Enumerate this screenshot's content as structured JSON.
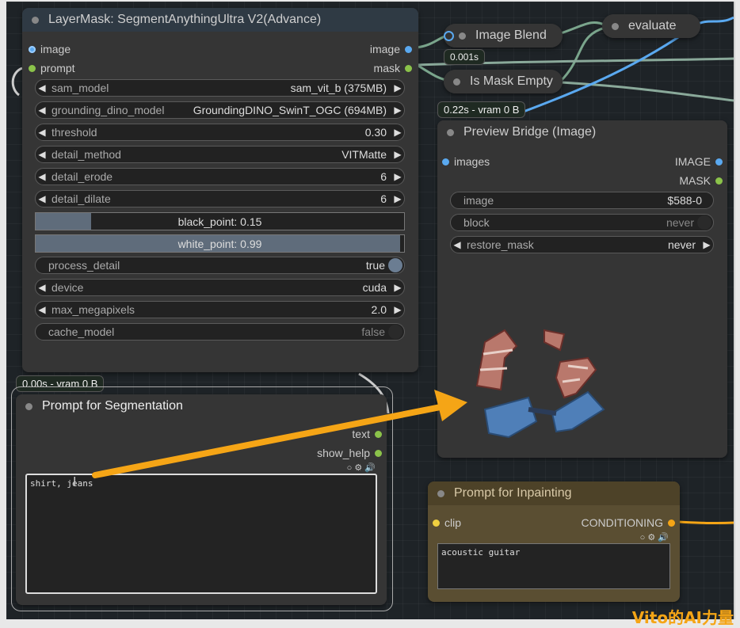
{
  "layer_mask": {
    "title": "LayerMask: SegmentAnythingUltra V2(Advance)",
    "inputs": [
      "image",
      "prompt"
    ],
    "outputs": [
      "image",
      "mask"
    ],
    "widgets": [
      {
        "label": "sam_model",
        "value": "sam_vit_b (375MB)"
      },
      {
        "label": "grounding_dino_model",
        "value": "GroundingDINO_SwinT_OGC (694MB)"
      },
      {
        "label": "threshold",
        "value": "0.30"
      },
      {
        "label": "detail_method",
        "value": "VITMatte"
      },
      {
        "label": "detail_erode",
        "value": "6"
      },
      {
        "label": "detail_dilate",
        "value": "6"
      }
    ],
    "black_point": "black_point: 0.15",
    "black_point_value": 0.15,
    "white_point": "white_point: 0.99",
    "white_point_value": 0.99,
    "process_detail": {
      "label": "process_detail",
      "value": "true"
    },
    "device": {
      "label": "device",
      "value": "cuda"
    },
    "max_megapixels": {
      "label": "max_megapixels",
      "value": "2.0"
    },
    "cache_model": {
      "label": "cache_model",
      "value": "false"
    }
  },
  "badges": {
    "segment": "0.00s - vram 0 B",
    "preview": "0.22s - vram 0 B",
    "blend": "0.001s"
  },
  "image_blend": {
    "title": "Image Blend"
  },
  "is_mask_empty": {
    "title": "Is Mask Empty"
  },
  "evaluate": {
    "title": "evaluate"
  },
  "preview_bridge": {
    "title": "Preview Bridge (Image)",
    "input": "images",
    "outputs": [
      "IMAGE",
      "MASK"
    ],
    "image": {
      "label": "image",
      "value": "$588-0"
    },
    "block": {
      "label": "block",
      "value": "never"
    },
    "restore_mask": {
      "label": "restore_mask",
      "value": "never"
    }
  },
  "prompt_seg": {
    "title": "Prompt for Segmentation",
    "outputs": [
      "text",
      "show_help"
    ],
    "text": "shirt, jeans"
  },
  "prompt_inpaint": {
    "title": "Prompt for Inpainting",
    "input": "clip",
    "output": "CONDITIONING",
    "text": "acoustic guitar"
  },
  "watermark": "Vito的AI力量",
  "colors": {
    "accent_arrow": "#f5a516",
    "wire_blue": "#5aa9f0",
    "inpaint_node": "#5a4e32"
  }
}
